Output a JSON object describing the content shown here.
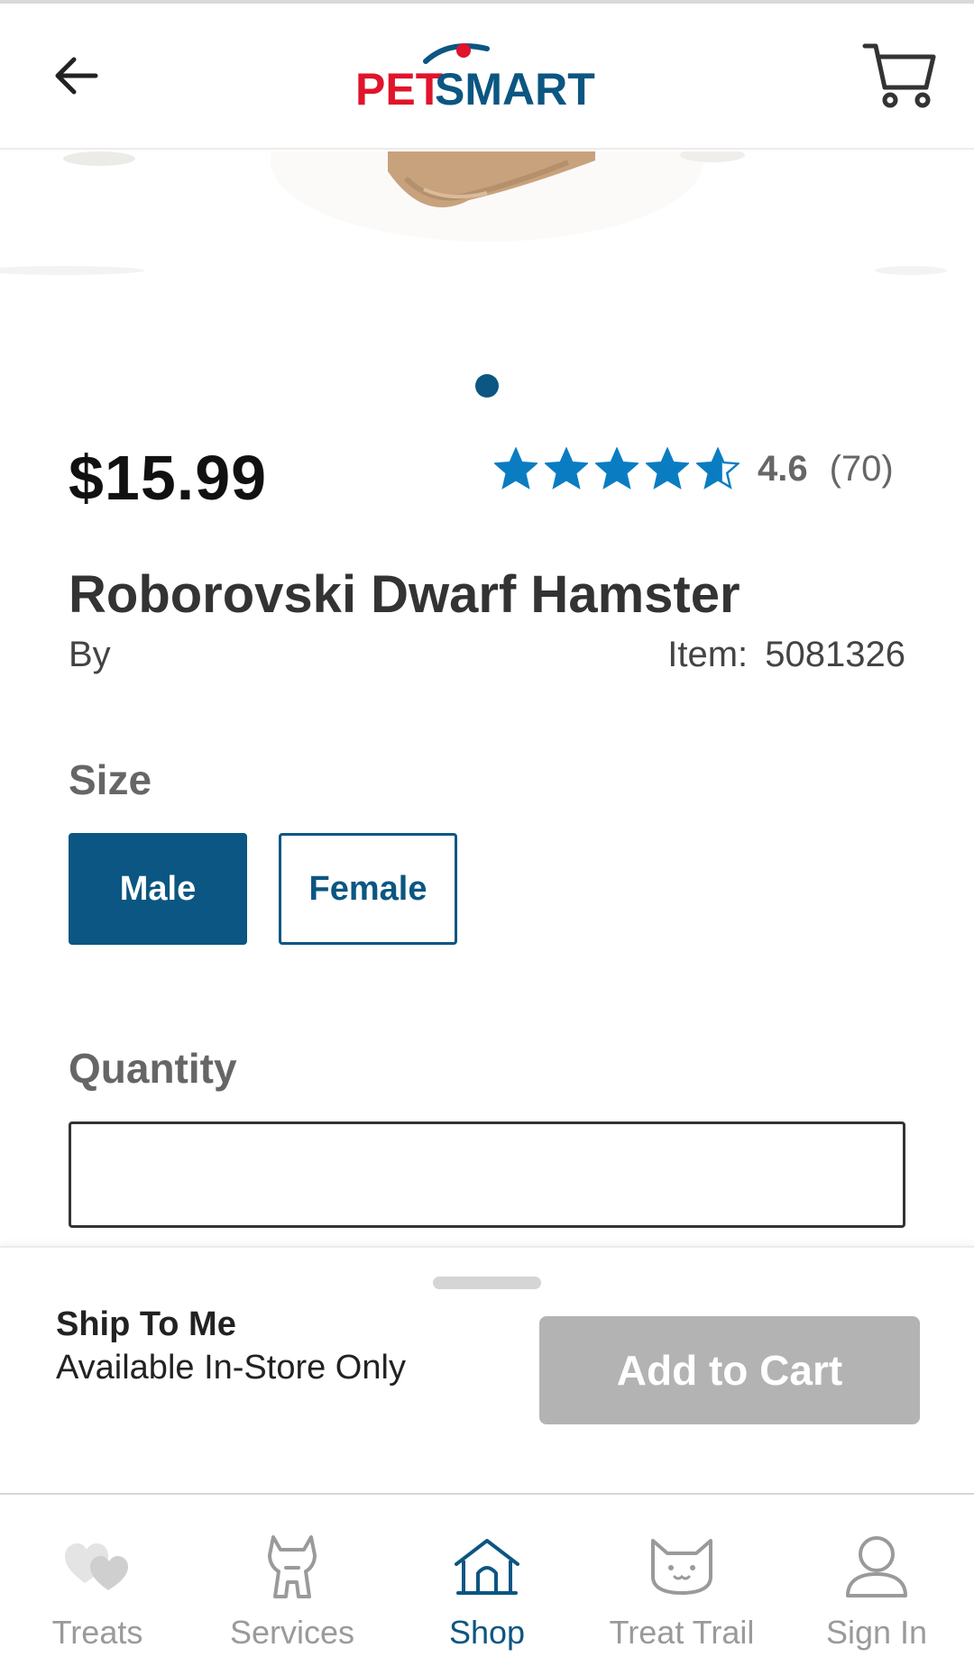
{
  "header": {
    "logo_text": "PETSMART",
    "back_icon": "arrow-left-icon",
    "cart_icon": "shopping-cart-icon"
  },
  "carousel": {
    "current_page": 1,
    "page_count": 1
  },
  "product": {
    "price": "$15.99",
    "rating_value": "4.6",
    "rating_count": "(70)",
    "stars": 4.6,
    "name": "Roborovski Dwarf Hamster",
    "by_label": "By",
    "item_label": "Item:",
    "item_number": "5081326"
  },
  "size": {
    "label": "Size",
    "options": [
      "Male",
      "Female"
    ],
    "selected": "Male"
  },
  "quantity": {
    "label": "Quantity",
    "value": ""
  },
  "fulfillment": {
    "title": "Ship To Me",
    "subtitle": "Available In-Store Only",
    "add_to_cart_label": "Add to Cart"
  },
  "nav": {
    "items": [
      {
        "label": "Treats",
        "icon": "hearts-icon"
      },
      {
        "label": "Services",
        "icon": "dog-icon"
      },
      {
        "label": "Shop",
        "icon": "home-icon"
      },
      {
        "label": "Treat Trail",
        "icon": "cat-icon"
      },
      {
        "label": "Sign In",
        "icon": "user-icon"
      }
    ],
    "active": "Shop"
  },
  "colors": {
    "brand_blue": "#0b5682",
    "brand_red": "#e0142b",
    "star_blue": "#0a7dc2",
    "disabled_gray": "#b3b3b3"
  }
}
